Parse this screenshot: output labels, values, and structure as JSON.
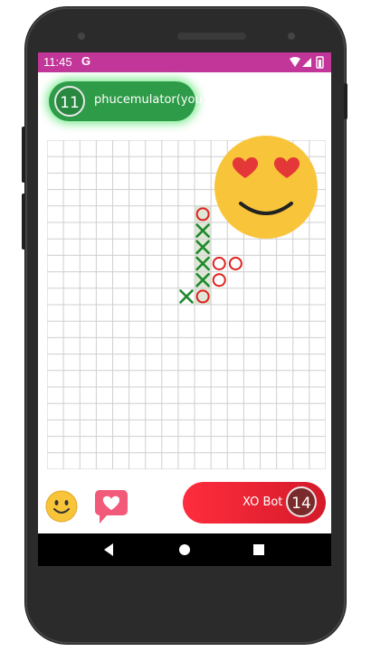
{
  "status_bar": {
    "time": "11:45",
    "g_label": "G",
    "color": "#c2369a"
  },
  "player": {
    "score": "11",
    "name": "phucemulator(you)",
    "color": "#2e9b48"
  },
  "bot": {
    "score": "14",
    "name": "XO Bot",
    "color": "#e8212f"
  },
  "board": {
    "columns": 17,
    "rows": 20,
    "highlight_color": "#dfe8d6",
    "marks": [
      {
        "col": 9,
        "row": 4,
        "mark": "O"
      },
      {
        "col": 9,
        "row": 5,
        "mark": "X"
      },
      {
        "col": 9,
        "row": 6,
        "mark": "X"
      },
      {
        "col": 9,
        "row": 7,
        "mark": "X"
      },
      {
        "col": 10,
        "row": 7,
        "mark": "O"
      },
      {
        "col": 11,
        "row": 7,
        "mark": "O"
      },
      {
        "col": 9,
        "row": 8,
        "mark": "X"
      },
      {
        "col": 10,
        "row": 8,
        "mark": "O"
      },
      {
        "col": 8,
        "row": 9,
        "mark": "X"
      },
      {
        "col": 9,
        "row": 9,
        "mark": "O"
      }
    ],
    "x_color": "#1f8a2e",
    "o_color": "#e02020"
  },
  "reaction": {
    "icon": "heart-eyes-emoji-icon"
  },
  "bottom_controls": {
    "emoji_icon": "smiley-emoji-icon",
    "heart_icon": "heart-chat-icon"
  },
  "nav": {
    "back": "back-icon",
    "home": "home-icon",
    "recents": "recents-icon"
  }
}
